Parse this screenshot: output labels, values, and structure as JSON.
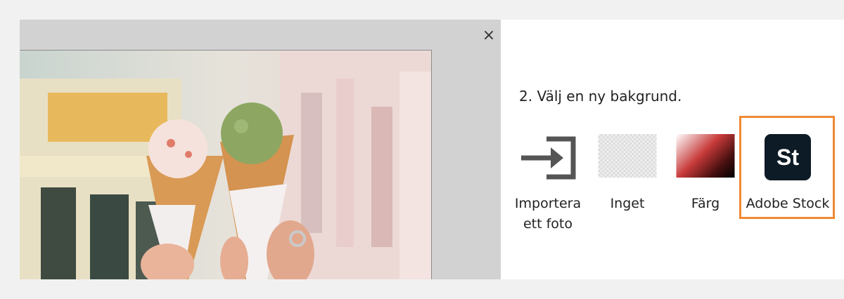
{
  "dialog": {
    "close_label": "×"
  },
  "panel": {
    "step_title": "2. Välj en ny bakgrund.",
    "options": [
      {
        "label": "Importera\nett foto",
        "icon": "import-icon"
      },
      {
        "label": "Inget",
        "icon": "transparent-thumbnail"
      },
      {
        "label": "Färg",
        "icon": "color-gradient-thumbnail"
      },
      {
        "label": "Adobe Stock",
        "icon": "adobe-stock-icon",
        "icon_text": "St",
        "highlighted": true
      }
    ]
  },
  "colors": {
    "highlight": "#f08a34",
    "stock_icon_bg": "#0d1b26",
    "panel_bg": "#ffffff",
    "canvas_bg": "#d2d2d2"
  }
}
